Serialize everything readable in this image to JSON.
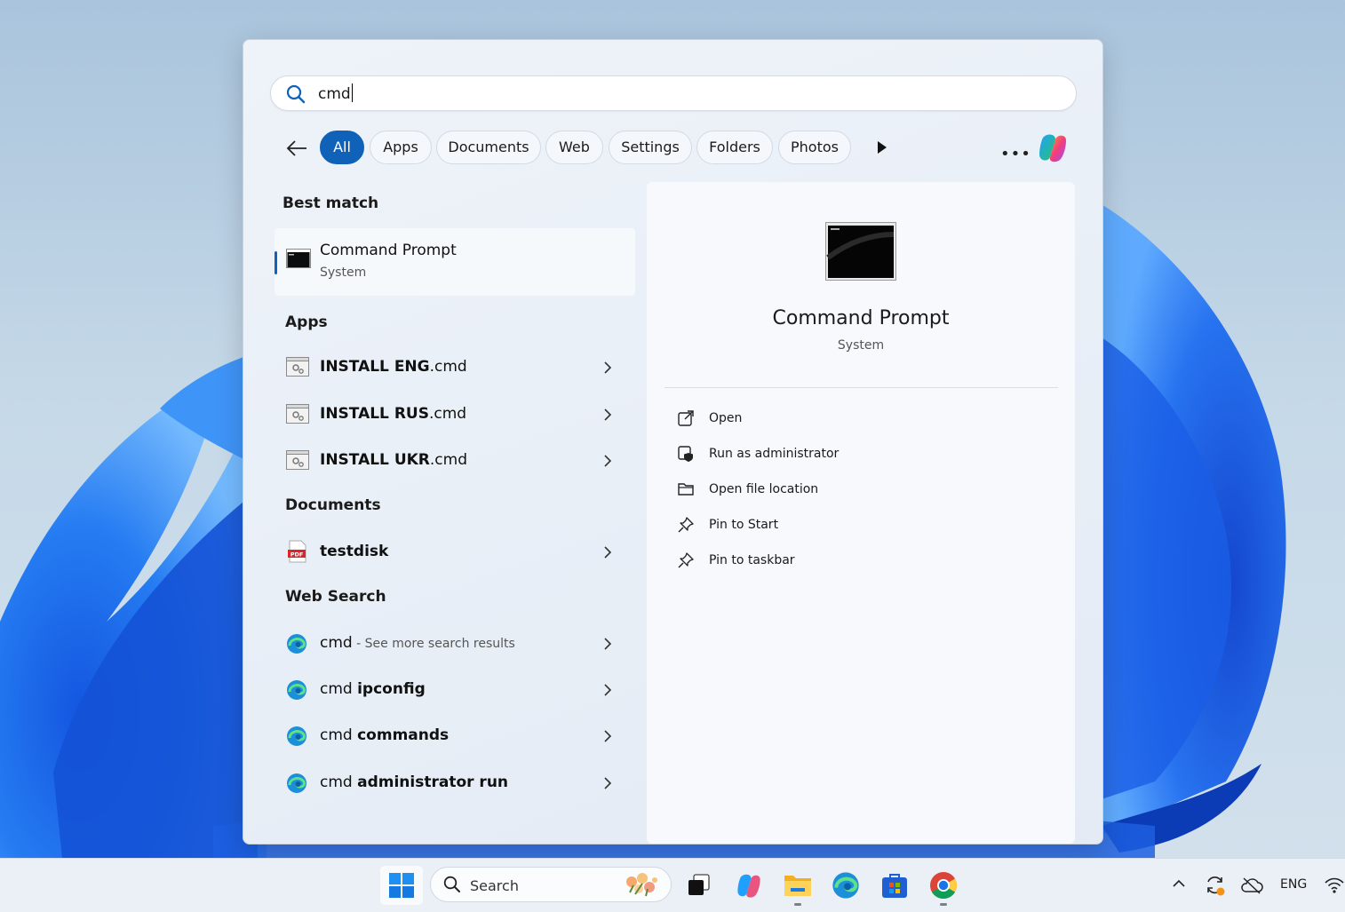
{
  "search": {
    "query": "cmd"
  },
  "filters": {
    "tabs": [
      {
        "label": "All",
        "active": true
      },
      {
        "label": "Apps"
      },
      {
        "label": "Documents"
      },
      {
        "label": "Web"
      },
      {
        "label": "Settings"
      },
      {
        "label": "Folders"
      },
      {
        "label": "Photos"
      }
    ]
  },
  "results": {
    "best_match_heading": "Best match",
    "best_match": {
      "title": "Command Prompt",
      "subtitle": "System"
    },
    "apps_heading": "Apps",
    "apps": [
      {
        "bold": "INSTALL ENG",
        "rest": ".cmd"
      },
      {
        "bold": "INSTALL RUS",
        "rest": ".cmd"
      },
      {
        "bold": "INSTALL UKR",
        "rest": ".cmd"
      }
    ],
    "documents_heading": "Documents",
    "documents": [
      {
        "bold": "testdisk"
      }
    ],
    "web_heading": "Web Search",
    "web": [
      {
        "prefix": "cmd",
        "sub": " - See more search results"
      },
      {
        "prefix": "cmd ",
        "bold": "ipconfig"
      },
      {
        "prefix": "cmd ",
        "bold": "commands"
      },
      {
        "prefix": "cmd ",
        "bold": "administrator run"
      }
    ]
  },
  "preview": {
    "title": "Command Prompt",
    "subtitle": "System",
    "actions": [
      {
        "label": "Open",
        "icon": "open-external-icon"
      },
      {
        "label": "Run as administrator",
        "icon": "shield-admin-icon"
      },
      {
        "label": "Open file location",
        "icon": "folder-icon"
      },
      {
        "label": "Pin to Start",
        "icon": "pin-icon"
      },
      {
        "label": "Pin to taskbar",
        "icon": "pin-icon"
      }
    ]
  },
  "taskbar": {
    "search_label": "Search",
    "language": "ENG"
  },
  "colors": {
    "accent": "#0f62b8",
    "panel_bg": "#eaf0f7",
    "preview_bg": "#f7f9fc"
  }
}
